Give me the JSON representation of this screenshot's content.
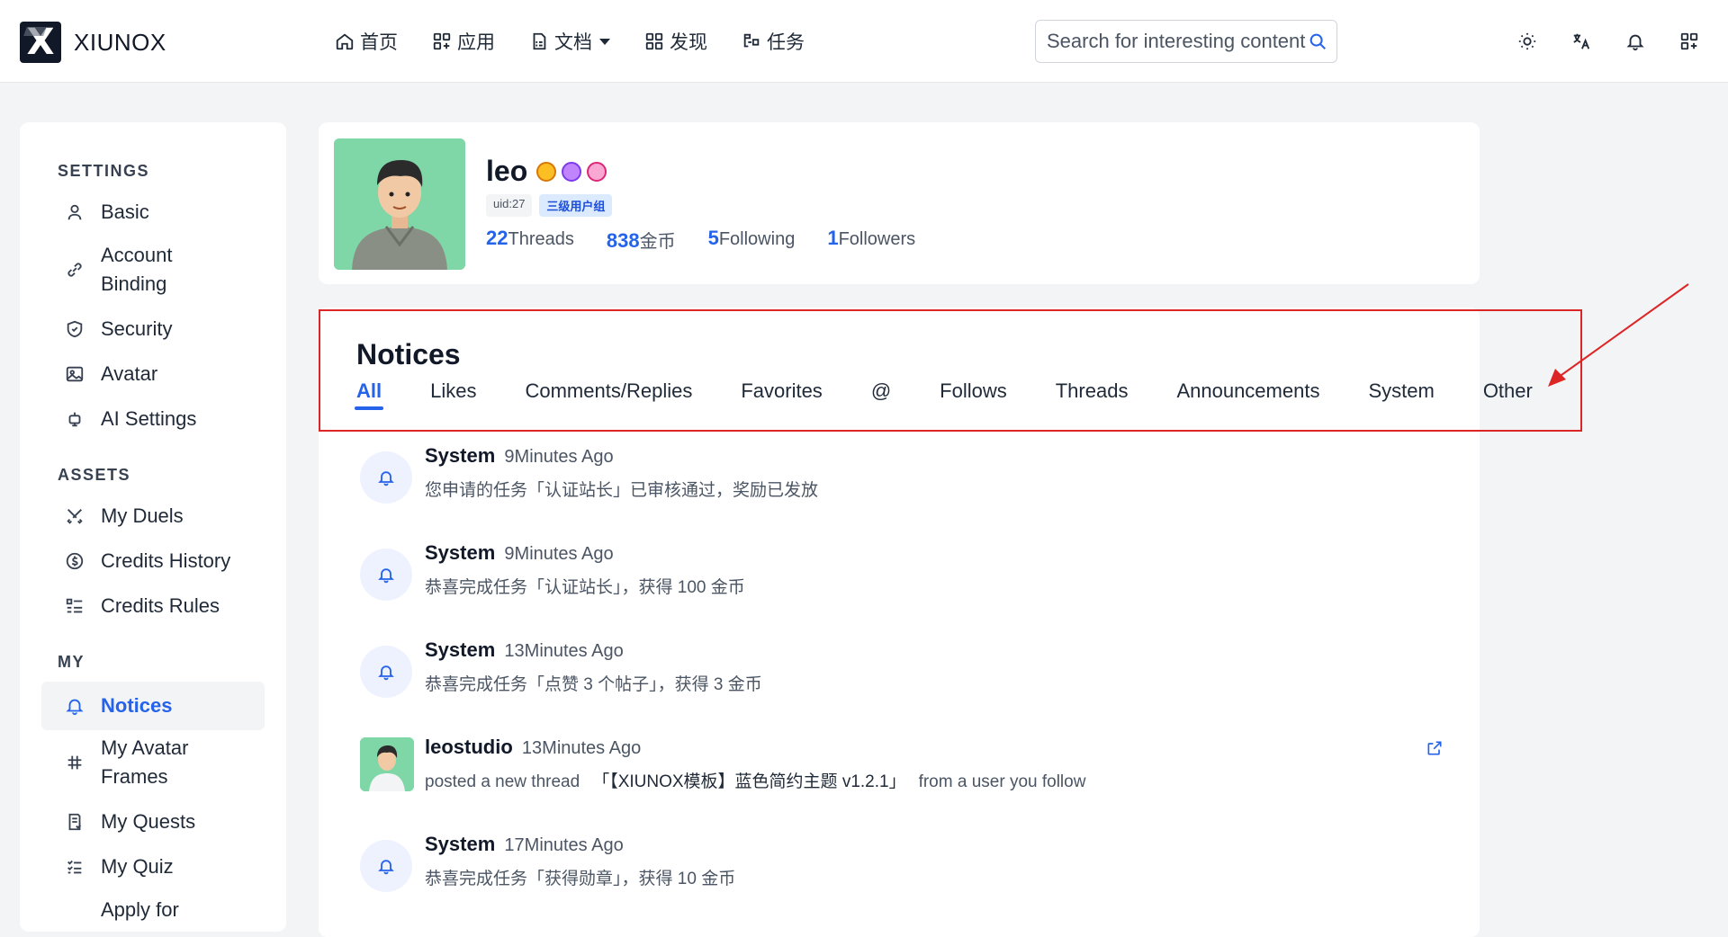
{
  "brand": {
    "name": "XIUNOX"
  },
  "nav": [
    {
      "label": "首页",
      "icon": "home-icon"
    },
    {
      "label": "应用",
      "icon": "apps-icon"
    },
    {
      "label": "文档",
      "icon": "docs-icon",
      "dropdown": true
    },
    {
      "label": "发现",
      "icon": "discover-icon"
    },
    {
      "label": "任务",
      "icon": "tasks-icon"
    }
  ],
  "search": {
    "placeholder": "Search for interesting content"
  },
  "header_icons": [
    "sun-icon",
    "translate-icon",
    "bell-icon",
    "grid-plus-icon"
  ],
  "sidebar": {
    "sections": [
      {
        "title": "SETTINGS",
        "items": [
          {
            "label": "Basic",
            "icon": "user-icon"
          },
          {
            "label": "Account Binding",
            "icon": "link-icon"
          },
          {
            "label": "Security",
            "icon": "shield-icon"
          },
          {
            "label": "Avatar",
            "icon": "image-icon"
          },
          {
            "label": "AI Settings",
            "icon": "robot-icon"
          }
        ]
      },
      {
        "title": "ASSETS",
        "items": [
          {
            "label": "My Duels",
            "icon": "swords-icon"
          },
          {
            "label": "Credits History",
            "icon": "coin-icon"
          },
          {
            "label": "Credits Rules",
            "icon": "list-icon"
          }
        ]
      },
      {
        "title": "MY",
        "items": [
          {
            "label": "Notices",
            "icon": "bell-icon",
            "active": true
          },
          {
            "label": "My Avatar Frames",
            "icon": "hash-icon"
          },
          {
            "label": "My Quests",
            "icon": "quest-icon"
          },
          {
            "label": "My Quiz",
            "icon": "checklist-icon"
          },
          {
            "label": "Apply for",
            "icon": ""
          }
        ]
      }
    ]
  },
  "profile": {
    "username": "leo",
    "uid": "uid:27",
    "group": "三级用户组",
    "stats": [
      {
        "value": "22",
        "label": "Threads"
      },
      {
        "value": "838",
        "label": "金币"
      },
      {
        "value": "5",
        "label": "Following"
      },
      {
        "value": "1",
        "label": "Followers"
      }
    ]
  },
  "notices": {
    "title": "Notices",
    "tabs": [
      "All",
      "Likes",
      "Comments/Replies",
      "Favorites",
      "@",
      "Follows",
      "Threads",
      "Announcements",
      "System",
      "Other"
    ],
    "active_tab": "All",
    "items": [
      {
        "name": "System",
        "time": "9Minutes Ago",
        "body": "您申请的任务「认证站长」已审核通过，奖励已发放",
        "type": "system"
      },
      {
        "name": "System",
        "time": "9Minutes Ago",
        "body": "恭喜完成任务「认证站长」，获得 100 金币",
        "type": "system"
      },
      {
        "name": "System",
        "time": "13Minutes Ago",
        "body": "恭喜完成任务「点赞 3 个帖子」，获得 3 金币",
        "type": "system"
      },
      {
        "name": "leostudio",
        "time": "13Minutes Ago",
        "body_prefix": "posted a new thread",
        "body_link": "「【XIUNOX模板】蓝色简约主题 v1.2.1」",
        "body_suffix": "from a user you follow",
        "type": "user"
      },
      {
        "name": "System",
        "time": "17Minutes Ago",
        "body": "恭喜完成任务「获得勋章」，获得 10 金币",
        "type": "system"
      }
    ]
  },
  "colors": {
    "accent": "#2563eb",
    "highlight": "#dc2626"
  }
}
